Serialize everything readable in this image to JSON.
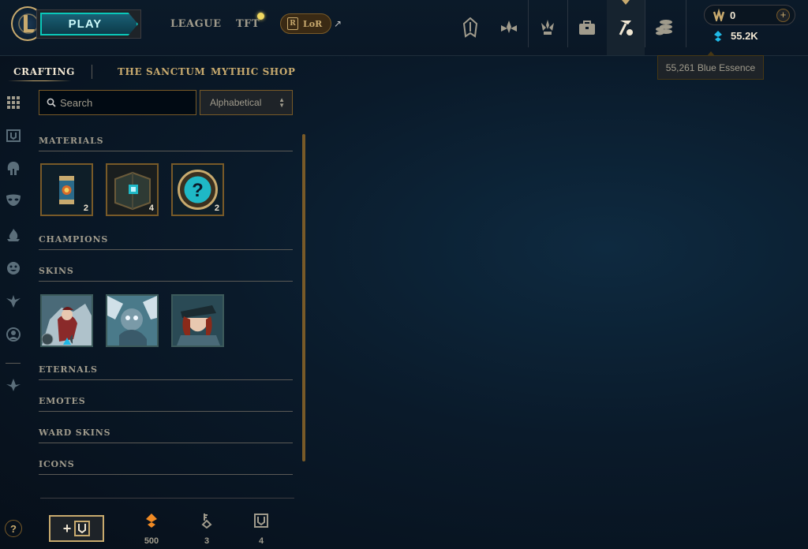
{
  "header": {
    "play_label": "PLAY",
    "nav": [
      "LEAGUE",
      "TFT"
    ],
    "lor_label": "LoR",
    "rp_value": "0",
    "be_value": "55.2K",
    "tooltip": "55,261 Blue Essence"
  },
  "subtabs": [
    "CRAFTING",
    "THE SANCTUM",
    "MYTHIC SHOP"
  ],
  "search": {
    "placeholder": "Search"
  },
  "sort": {
    "selected": "Alphabetical"
  },
  "sections": {
    "materials": "MATERIALS",
    "champions": "CHAMPIONS",
    "skins": "SKINS",
    "eternals": "ETERNALS",
    "emotes": "EMOTES",
    "ward_skins": "WARD SKINS",
    "icons": "ICONS"
  },
  "materials": [
    {
      "name": "capsule",
      "count": "2"
    },
    {
      "name": "chest",
      "count": "4"
    },
    {
      "name": "mystery-orb",
      "count": "2"
    }
  ],
  "bottom": {
    "orange_essence": "500",
    "keys": "3",
    "chests": "4"
  },
  "help_label": "?",
  "colors": {
    "gold": "#c8aa6e",
    "blue_essence": "#1fb8e6",
    "orange_essence": "#f08a24"
  }
}
